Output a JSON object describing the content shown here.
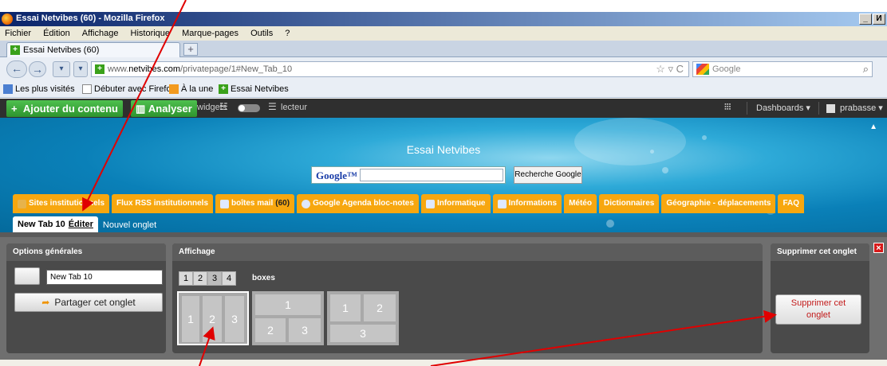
{
  "window": {
    "title": "Essai Netvibes (60) - Mozilla Firefox",
    "controls": [
      "_",
      "И"
    ]
  },
  "menu": [
    "Fichier",
    "Édition",
    "Affichage",
    "Historique",
    "Marque-pages",
    "Outils",
    "?"
  ],
  "browser_tab": {
    "label": "Essai Netvibes (60)",
    "new_tab": "+"
  },
  "url": {
    "prefix": "www.",
    "domain": "netvibes.com",
    "path": "/privatepage/1#New_Tab_10",
    "star": "☆ ▿ C"
  },
  "search": {
    "placeholder": "Google"
  },
  "bookmarks": [
    "Les plus visités",
    "Débuter avec Firefox",
    "À la une",
    "Essai Netvibes"
  ],
  "nv_toolbar": {
    "add_content": "Ajouter du contenu",
    "analyse": "Analyser",
    "widgets": "widgets",
    "reader": "lecteur",
    "dashboards": "Dashboards ▾",
    "user": "prabasse ▾"
  },
  "header": {
    "site_title": "Essai Netvibes",
    "google_logo": "Google™",
    "search_button": "Recherche Google",
    "collapse": "▲"
  },
  "tabs": [
    {
      "label": "Sites institutionnels",
      "count": ""
    },
    {
      "label": "Flux RSS institutionnels",
      "count": ""
    },
    {
      "label": "boîtes mail",
      "count": "(60)"
    },
    {
      "label": "Google Agenda bloc-notes",
      "count": ""
    },
    {
      "label": "Informatique",
      "count": ""
    },
    {
      "label": "Informations",
      "count": ""
    },
    {
      "label": "Météo",
      "count": ""
    },
    {
      "label": "Dictionnaires",
      "count": ""
    },
    {
      "label": "Géographie - déplacements",
      "count": ""
    },
    {
      "label": "FAQ",
      "count": ""
    }
  ],
  "subtabs": {
    "active": "New Tab 10",
    "edit": "Éditer",
    "new": "Nouvel onglet"
  },
  "panel": {
    "general_title": "Options générales",
    "tab_name": "New Tab 10",
    "share": "Partager cet onglet",
    "display_title": "Affichage",
    "columns": [
      "1",
      "2",
      "3",
      "4"
    ],
    "selected_columns": "3",
    "boxes_label": "boxes",
    "layouts": [
      {
        "cells": [
          "1",
          "2",
          "3"
        ],
        "selected": true
      },
      {
        "cells": [
          "1",
          "2",
          "3"
        ],
        "selected": false
      },
      {
        "cells": [
          "1",
          "2",
          "3"
        ],
        "selected": false
      }
    ],
    "delete_title": "Supprimer cet onglet",
    "delete_button_line1": "Supprimer cet",
    "delete_button_line2": "onglet",
    "close": "×"
  },
  "colors": {
    "tab_orange": "#f7a70f",
    "nv_green": "#3aa11a",
    "annotation_red": "#e00000",
    "delete_red": "#c21a1a"
  }
}
